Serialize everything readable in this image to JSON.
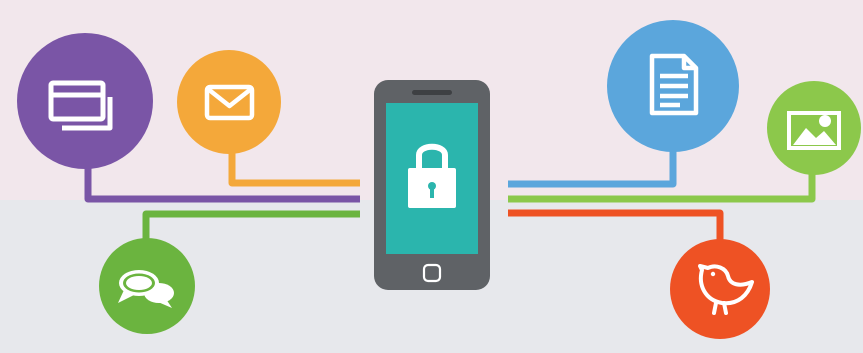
{
  "colors": {
    "background_top": "#f2e7ec",
    "background_bottom": "#e7e8ec",
    "purple": "#7a55a6",
    "orange": "#f4a83a",
    "green": "#6bb43f",
    "blue": "#5ba6dc",
    "light_green": "#8cc84b",
    "red": "#ee5224",
    "phone_body": "#5f6266",
    "screen": "#2bb5ad"
  },
  "phone": {
    "lock_icon": "padlock-icon",
    "home_button_icon": "rounded-square-icon"
  },
  "nodes": [
    {
      "id": "cards",
      "icon": "credit-cards-icon",
      "color": "purple",
      "side": "left"
    },
    {
      "id": "mail",
      "icon": "envelope-icon",
      "color": "orange",
      "side": "left"
    },
    {
      "id": "chat",
      "icon": "speech-bubbles-icon",
      "color": "green",
      "side": "left"
    },
    {
      "id": "document",
      "icon": "document-icon",
      "color": "blue",
      "side": "right"
    },
    {
      "id": "photo",
      "icon": "landscape-photo-icon",
      "color": "light_green",
      "side": "right"
    },
    {
      "id": "bird",
      "icon": "bird-icon",
      "color": "red",
      "side": "right"
    }
  ]
}
